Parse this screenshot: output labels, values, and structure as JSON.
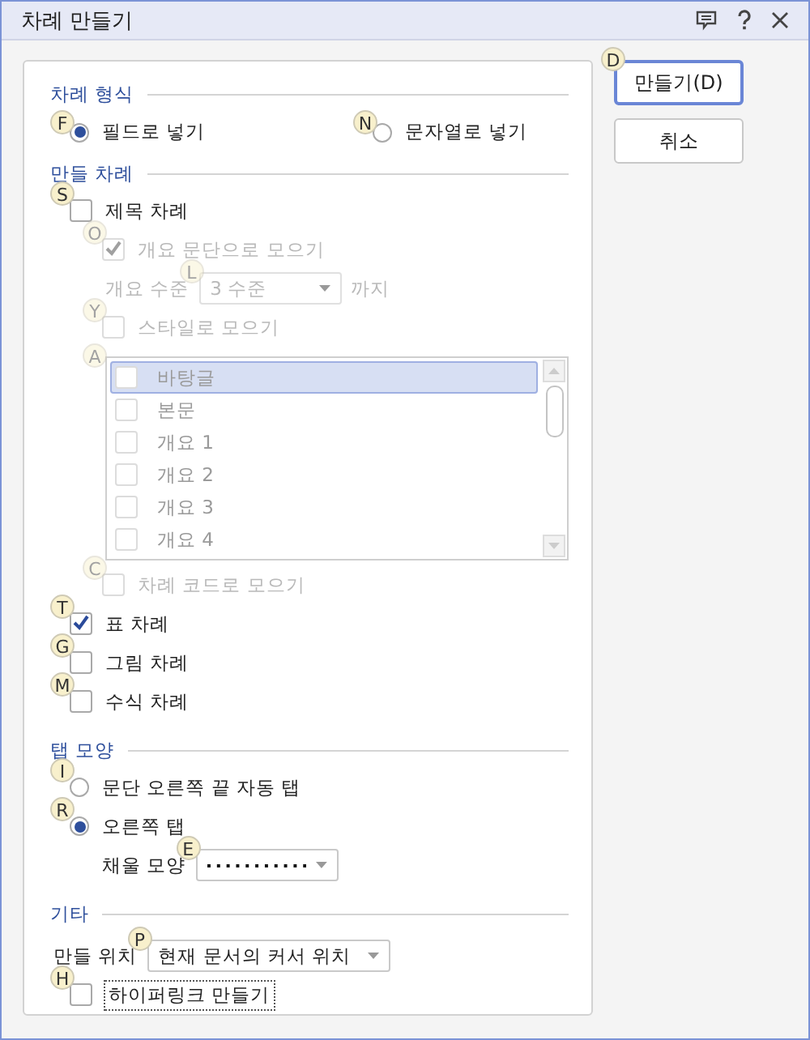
{
  "window": {
    "title": "차례 만들기"
  },
  "format": {
    "heading": "차례 형식",
    "options": [
      {
        "label": "필드로 넣기",
        "key": "F",
        "selected": true
      },
      {
        "label": "문자열로 넣기",
        "key": "N",
        "selected": false
      }
    ]
  },
  "make": {
    "heading": "만들 차례",
    "items": [
      {
        "kind": "checkbox",
        "label": "제목 차례",
        "key": "S",
        "checked": false,
        "children": [
          {
            "kind": "checkbox",
            "label": "개요 문단으로 모으기",
            "key": "O",
            "checked": true,
            "disabled": true
          },
          {
            "kind": "level",
            "label": "개요 수준",
            "key": "L",
            "value": "3 수준",
            "suffix": "까지",
            "disabled": true
          },
          {
            "kind": "checkbox",
            "label": "스타일로 모으기",
            "key": "Y",
            "checked": false,
            "disabled": true
          },
          {
            "kind": "list",
            "key": "A",
            "disabled": true,
            "rows": [
              {
                "label": "바탕글",
                "checked": false,
                "selected": true
              },
              {
                "label": "본문",
                "checked": false,
                "selected": false
              },
              {
                "label": "개요 1",
                "checked": false,
                "selected": false
              },
              {
                "label": "개요 2",
                "checked": false,
                "selected": false
              },
              {
                "label": "개요 3",
                "checked": false,
                "selected": false
              },
              {
                "label": "개요 4",
                "checked": false,
                "selected": false
              }
            ]
          },
          {
            "kind": "checkbox",
            "label": "차례 코드로 모으기",
            "key": "C",
            "checked": false,
            "disabled": true
          }
        ]
      },
      {
        "kind": "checkbox",
        "label": "표 차례",
        "key": "T",
        "checked": true
      },
      {
        "kind": "checkbox",
        "label": "그림 차례",
        "key": "G",
        "checked": false
      },
      {
        "kind": "checkbox",
        "label": "수식 차례",
        "key": "M",
        "checked": false
      }
    ]
  },
  "tab": {
    "heading": "탭 모양",
    "options": [
      {
        "label": "문단 오른쪽 끝 자동 탭",
        "key": "I",
        "selected": false
      },
      {
        "label": "오른쪽 탭",
        "key": "R",
        "selected": true
      }
    ],
    "fill": {
      "label": "채울 모양",
      "key": "E"
    }
  },
  "etc": {
    "heading": "기타",
    "position": {
      "label": "만들 위치",
      "key": "P",
      "value": "현재 문서의 커서 위치"
    },
    "hyperlink": {
      "label": "하이퍼링크 만들기",
      "key": "H",
      "checked": false,
      "focused": true
    }
  },
  "buttons": [
    {
      "label": "만들기(D)",
      "key": "D",
      "default": true
    },
    {
      "label": "취소",
      "default": false
    }
  ]
}
